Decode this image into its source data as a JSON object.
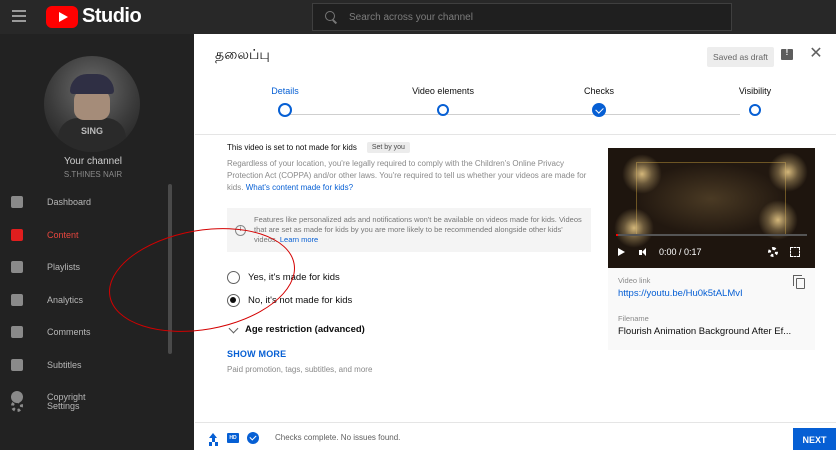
{
  "app": {
    "title": "Studio",
    "search_placeholder": "Search across your channel"
  },
  "sidebar": {
    "avatar_text": "SING",
    "channel_title": "Your channel",
    "channel_name": "S.THINES NAIR",
    "items": [
      {
        "label": "Dashboard",
        "icon": "dashboard-icon"
      },
      {
        "label": "Content",
        "icon": "content-icon",
        "active": true
      },
      {
        "label": "Playlists",
        "icon": "playlists-icon"
      },
      {
        "label": "Analytics",
        "icon": "analytics-icon"
      },
      {
        "label": "Comments",
        "icon": "comments-icon"
      },
      {
        "label": "Subtitles",
        "icon": "subtitles-icon"
      },
      {
        "label": "Copyright",
        "icon": "copyright-icon"
      }
    ],
    "settings_label": "Settings"
  },
  "dialog": {
    "title": "தலைப்பு",
    "saved_label": "Saved as draft",
    "steps": [
      {
        "label": "Details",
        "state": "active"
      },
      {
        "label": "Video elements",
        "state": "pending"
      },
      {
        "label": "Checks",
        "state": "done"
      },
      {
        "label": "Visibility",
        "state": "pending"
      }
    ],
    "kids": {
      "heading": "This video is set to not made for kids",
      "badge": "Set by you",
      "description": "Regardless of your location, you're legally required to comply with the Children's Online Privacy Protection Act (COPPA) and/or other laws. You're required to tell us whether your videos are made for kids.",
      "description_link": "What's content made for kids?",
      "info": "Features like personalized ads and notifications won't be available on videos made for kids. Videos that are set as made for kids by you are more likely to be recommended alongside other kids' videos.",
      "info_link": "Learn more",
      "option_yes": "Yes, it's made for kids",
      "option_no": "No, it's not made for kids",
      "selected": "no"
    },
    "age_restriction": "Age restriction (advanced)",
    "show_more": "SHOW MORE",
    "show_more_sub": "Paid promotion, tags, subtitles, and more",
    "preview": {
      "time": "0:00 / 0:17",
      "link_label": "Video link",
      "link": "https://youtu.be/Hu0k5tALMvI",
      "filename_label": "Filename",
      "filename": "Flourish Animation Background After Ef..."
    },
    "footer": {
      "hd_badge": "HD",
      "status": "Checks complete. No issues found.",
      "next_label": "NEXT"
    }
  },
  "colors": {
    "accent": "#065fd4",
    "brand_red": "#ff0000",
    "annotation": "#d40000"
  }
}
